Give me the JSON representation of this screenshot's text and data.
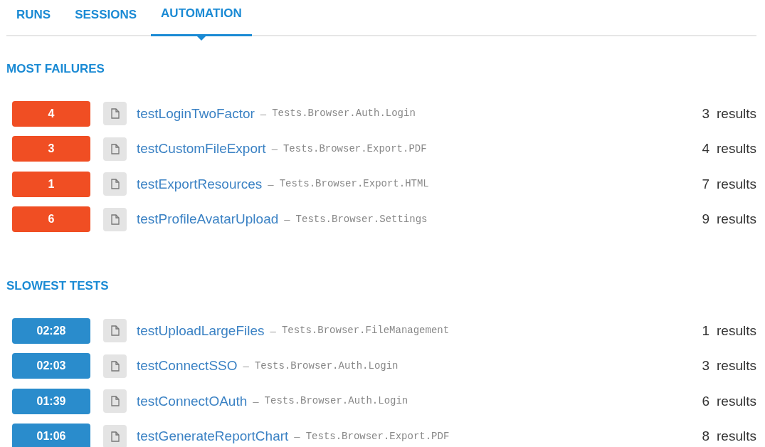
{
  "tabs": [
    {
      "label": "RUNS",
      "selected": false
    },
    {
      "label": "SESSIONS",
      "selected": false
    },
    {
      "label": "AUTOMATION",
      "selected": true
    }
  ],
  "sections": [
    {
      "title": "MOST FAILURES",
      "kind": "failures",
      "rows": [
        {
          "badge": "4",
          "name": "testLoginTwoFactor",
          "separator": "–",
          "path": "Tests.Browser.Auth.Login",
          "count": "3",
          "unit": "results"
        },
        {
          "badge": "3",
          "name": "testCustomFileExport",
          "separator": "–",
          "path": "Tests.Browser.Export.PDF",
          "count": "4",
          "unit": "results"
        },
        {
          "badge": "1",
          "name": "testExportResources",
          "separator": "–",
          "path": "Tests.Browser.Export.HTML",
          "count": "7",
          "unit": "results"
        },
        {
          "badge": "6",
          "name": "testProfileAvatarUpload",
          "separator": "–",
          "path": "Tests.Browser.Settings",
          "count": "9",
          "unit": "results"
        }
      ]
    },
    {
      "title": "SLOWEST TESTS",
      "kind": "durations",
      "rows": [
        {
          "badge": "02:28",
          "name": "testUploadLargeFiles",
          "separator": "–",
          "path": "Tests.Browser.FileManagement",
          "count": "1",
          "unit": "results"
        },
        {
          "badge": "02:03",
          "name": "testConnectSSO",
          "separator": "–",
          "path": "Tests.Browser.Auth.Login",
          "count": "3",
          "unit": "results"
        },
        {
          "badge": "01:39",
          "name": "testConnectOAuth",
          "separator": "–",
          "path": "Tests.Browser.Auth.Login",
          "count": "6",
          "unit": "results"
        },
        {
          "badge": "01:06",
          "name": "testGenerateReportChart",
          "separator": "–",
          "path": "Tests.Browser.Export.PDF",
          "count": "8",
          "unit": "results"
        }
      ]
    }
  ]
}
